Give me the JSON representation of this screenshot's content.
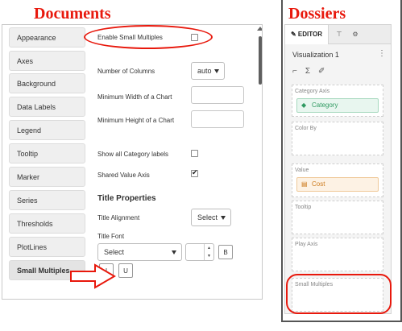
{
  "headings": {
    "documents": "Documents",
    "dossiers": "Dossiers"
  },
  "colors": {
    "annotation": "#e8180c",
    "category_green": "#2f9a61",
    "cost_orange": "#cc7a1c"
  },
  "documents": {
    "sidebar": [
      "Appearance",
      "Axes",
      "Background",
      "Data Labels",
      "Legend",
      "Tooltip",
      "Marker",
      "Series",
      "Thresholds",
      "PlotLines",
      "Small Multiples"
    ],
    "active_item": "Small Multiples",
    "enable_small_multiples": {
      "label": "Enable Small Multiples",
      "checked": false
    },
    "number_of_columns": {
      "label": "Number of Columns",
      "value": "auto"
    },
    "min_width": {
      "label": "Minimum Width of a Chart",
      "value": ""
    },
    "min_height": {
      "label": "Minimum Height of a Chart",
      "value": ""
    },
    "show_all_category_labels": {
      "label": "Show all Category labels",
      "checked": false
    },
    "shared_value_axis": {
      "label": "Shared Value Axis",
      "checked": true
    },
    "title_properties": "Title Properties",
    "title_alignment": {
      "label": "Title Alignment",
      "value": "Select"
    },
    "title_font": {
      "label": "Title Font",
      "value": "Select"
    },
    "font_buttons": {
      "bold": "B",
      "italic": "I",
      "underline": "U"
    }
  },
  "dossiers": {
    "tabs": {
      "editor": "EDITOR",
      "filter_icon": "filter-icon",
      "format_icon": "format-icon"
    },
    "viz_title": "Visualization 1",
    "zones": {
      "category_axis": {
        "label": "Category Axis",
        "item": "Category"
      },
      "color_by": {
        "label": "Color By"
      },
      "value": {
        "label": "Value",
        "item": "Cost"
      },
      "tooltip": {
        "label": "Tooltip"
      },
      "play_axis": {
        "label": "Play Axis"
      },
      "small_multiples": {
        "label": "Small Multiples"
      }
    }
  }
}
